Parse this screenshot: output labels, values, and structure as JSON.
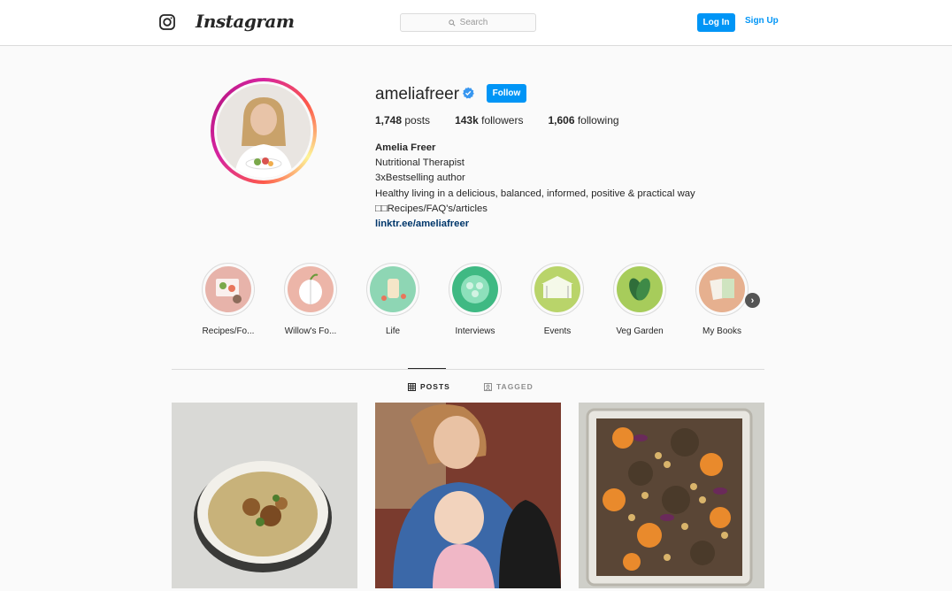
{
  "header": {
    "logo_text": "Instagram",
    "search_placeholder": "Search",
    "login_label": "Log In",
    "signup_label": "Sign Up"
  },
  "profile": {
    "username": "ameliafreer",
    "follow_label": "Follow",
    "stats": [
      {
        "value": "1,748",
        "label": "posts"
      },
      {
        "value": "143k",
        "label": "followers"
      },
      {
        "value": "1,606",
        "label": "following"
      }
    ],
    "bio": {
      "name": "Amelia Freer",
      "lines": [
        "Nutritional Therapist",
        "3xBestselling author",
        "Healthy living in a delicious, balanced, informed, positive & practical way",
        "□□Recipes/FAQ's/articles"
      ],
      "link": "linktr.ee/ameliafreer"
    }
  },
  "highlights": [
    {
      "label": "Recipes/Fo...",
      "color": "#e7b3aa"
    },
    {
      "label": "Willow's Fo...",
      "color": "#ecb5a8"
    },
    {
      "label": "Life",
      "color": "#8ed6b4"
    },
    {
      "label": "Interviews",
      "color": "#3fb983"
    },
    {
      "label": "Events",
      "color": "#b9d46a"
    },
    {
      "label": "Veg Garden",
      "color": "#a7cc5b"
    },
    {
      "label": "My Books",
      "color": "#e6b08f"
    }
  ],
  "tabs": {
    "posts": "POSTS",
    "tagged": "TAGGED"
  },
  "colors": {
    "accent": "#0095f6",
    "link": "#00376b"
  }
}
